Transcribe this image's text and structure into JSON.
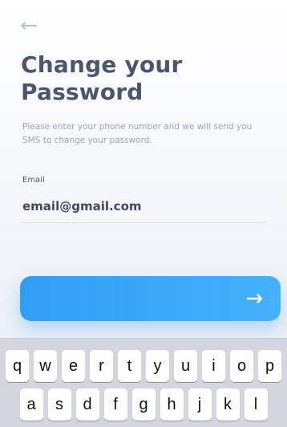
{
  "header": {
    "back_icon": "arrow-left-icon"
  },
  "content": {
    "title": "Change your\nPassword",
    "subtitle": "Please enter your phone number and we will send you SMS to change your password."
  },
  "form": {
    "email_label": "Email",
    "email_value": "email@gmail.com",
    "submit_icon": "arrow-right-icon"
  },
  "keyboard": {
    "row1": [
      "q",
      "w",
      "e",
      "r",
      "t",
      "y",
      "u",
      "i",
      "o",
      "p"
    ],
    "row2": [
      "a",
      "s",
      "d",
      "f",
      "g",
      "h",
      "j",
      "k",
      "l"
    ]
  },
  "colors": {
    "title": "#4a5670",
    "accent": "#3aa8f8",
    "muted_text": "#9aa3b5",
    "keyboard_bg": "#d3d6de"
  }
}
